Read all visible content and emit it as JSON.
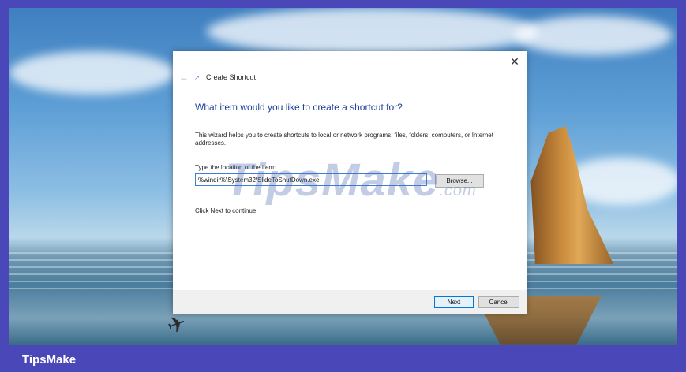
{
  "dialog": {
    "title": "Create Shortcut",
    "close_glyph": "✕",
    "back_glyph": "←",
    "heading": "What item would you like to create a shortcut for?",
    "description": "This wizard helps you to create shortcuts to local or network programs, files, folders, computers, or Internet addresses.",
    "location_label": "Type the location of the item:",
    "location_value": "%windir%\\System32\\SlideToShutDown.exe",
    "browse_label": "Browse...",
    "continue_text": "Click Next to continue.",
    "next_label": "Next",
    "cancel_label": "Cancel"
  },
  "watermark": {
    "main": "TipsMake",
    "suffix": ".com"
  },
  "branding": {
    "label": "TipsMake"
  },
  "colors": {
    "frame": "#4a47b8",
    "heading": "#1e3f99",
    "input_border": "#3c7fd4"
  },
  "icons": {
    "title": "shortcut-wizard-icon",
    "back": "back-arrow-icon",
    "close": "close-icon"
  }
}
